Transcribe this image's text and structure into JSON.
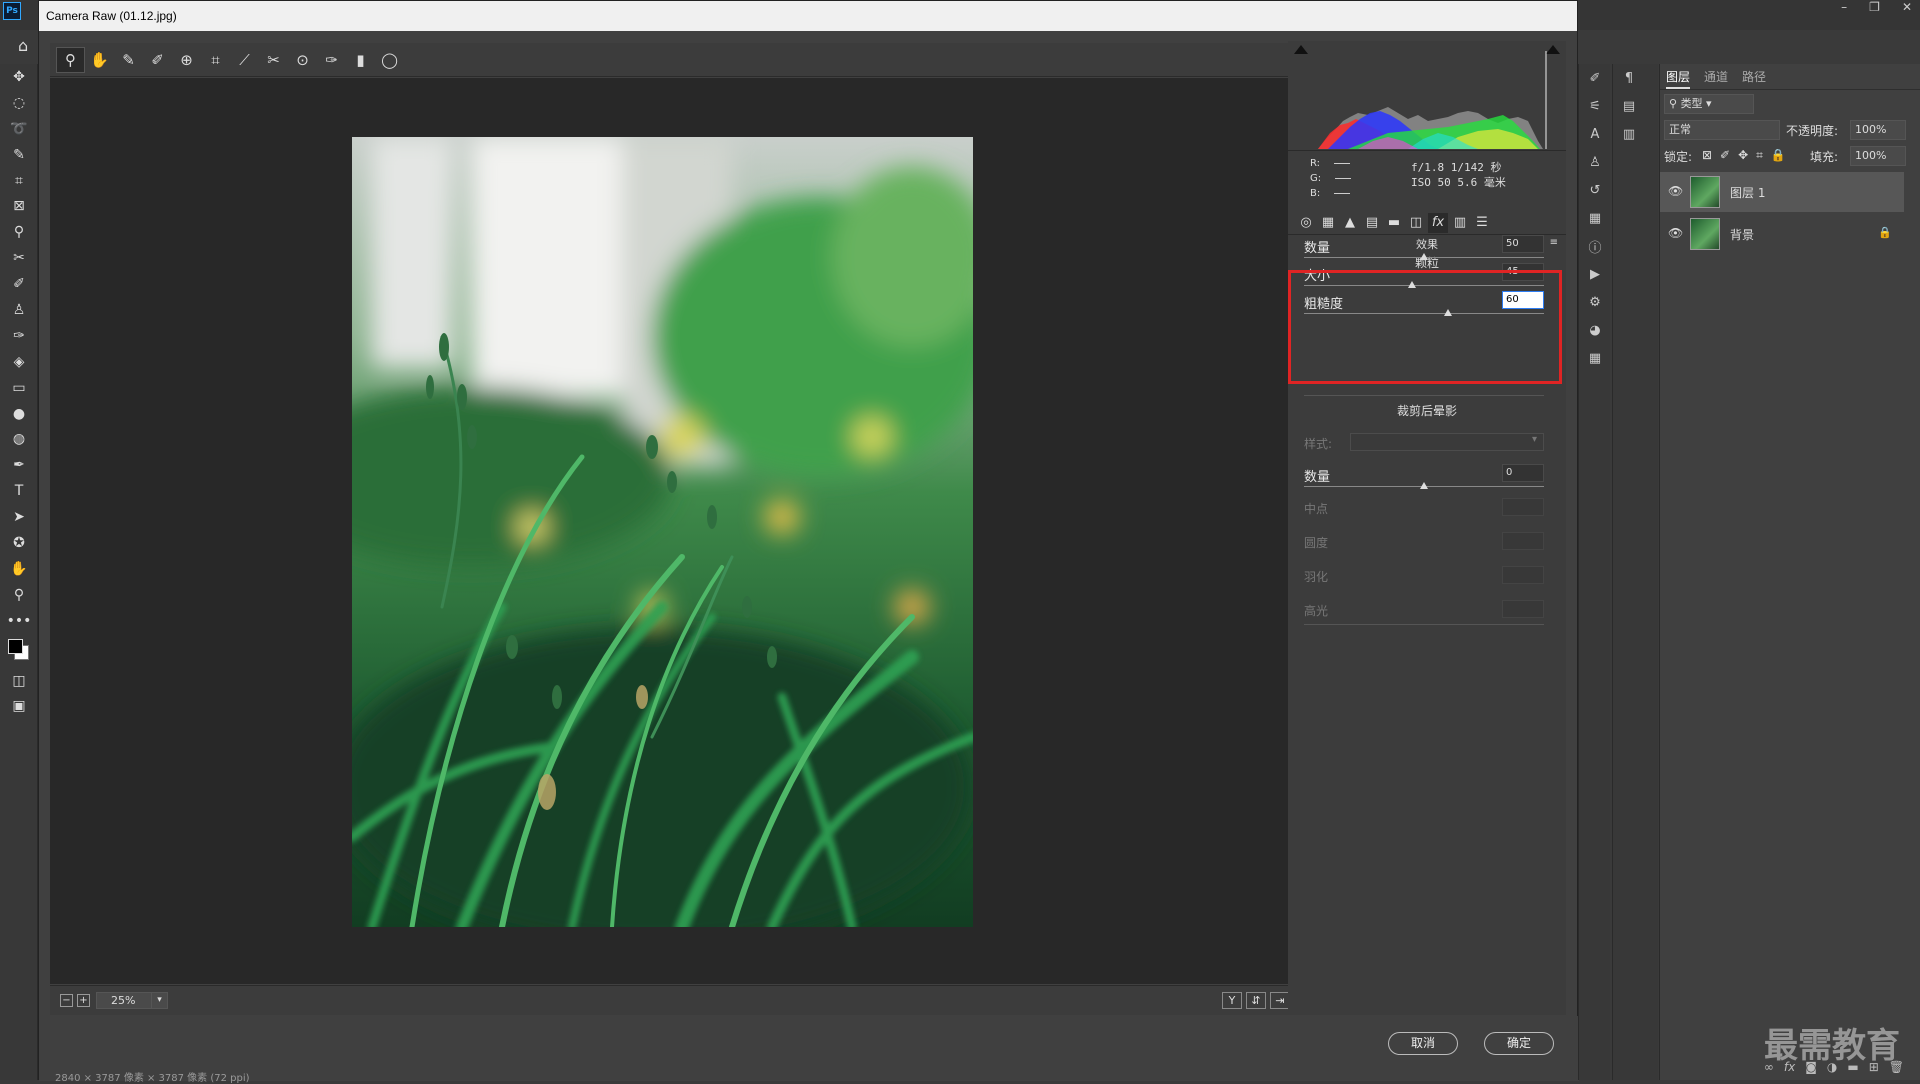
{
  "app": {
    "logo": "Ps",
    "window_controls": [
      "–",
      "❐",
      "✕"
    ]
  },
  "dialog": {
    "title": "Camera Raw (01.12.jpg)",
    "toolbar_icons": [
      "zoom-icon",
      "hand-icon",
      "white-balance-icon",
      "color-sampler-icon",
      "targeted-adjust-icon",
      "crop-icon",
      "straighten-icon",
      "spot-removal-icon",
      "red-eye-icon",
      "brush-icon",
      "graduated-filter-icon",
      "radial-filter-icon"
    ],
    "zoom": "25%",
    "cancel": "取消",
    "ok": "确定",
    "status_text": "2840 × 3787 像素 × 3787 像素 (72 ppi)"
  },
  "info": {
    "r": "R:",
    "g": "G:",
    "b": "B:",
    "aperture_shutter": "f/1.8  1/142 秒",
    "iso_focal": "ISO 50  5.6 毫米"
  },
  "effects": {
    "panel_title": "效果",
    "grain_title": "颗粒",
    "grain": [
      {
        "label": "数量",
        "value": "50",
        "level": 50
      },
      {
        "label": "大小",
        "value": "45",
        "level": 45
      },
      {
        "label": "粗糙度",
        "value": "60",
        "level": 60
      }
    ],
    "vignette_title": "裁剪后晕影",
    "style_label": "样式:",
    "amount_label": "数量",
    "amount_value": "0",
    "amount_level": 50,
    "disabled": [
      "中点",
      "圆度",
      "羽化",
      "高光"
    ]
  },
  "layers": {
    "tabs": [
      "图层",
      "通道",
      "路径"
    ],
    "filter": "类型",
    "blend": "正常",
    "opacity_label": "不透明度:",
    "opacity": "100%",
    "lock_label": "锁定:",
    "fill_label": "填充:",
    "fill": "100%",
    "items": [
      {
        "name": "图层 1"
      },
      {
        "name": "背景"
      }
    ]
  },
  "watermark": "最需教育"
}
